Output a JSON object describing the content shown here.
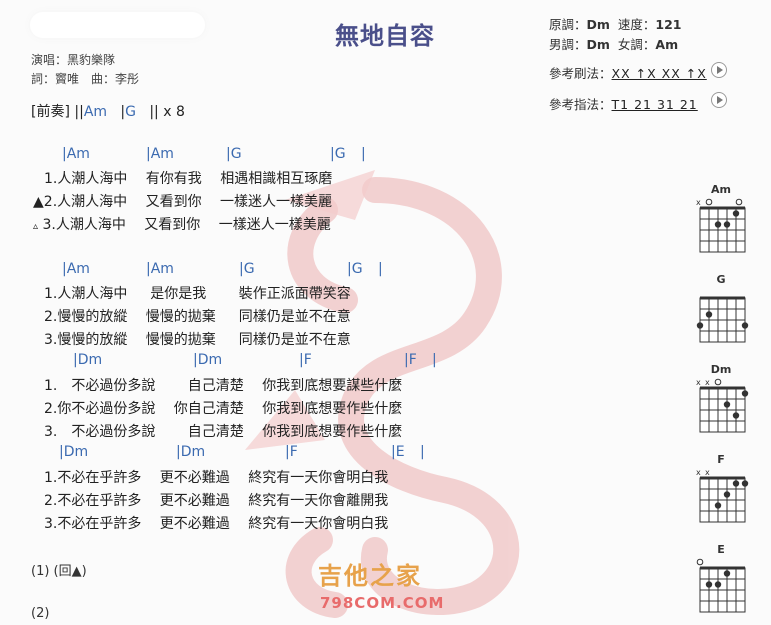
{
  "title": "無地自容",
  "meta": {
    "singer": "演唱：黑豹樂隊",
    "writers": "詞：竇唯　曲：李彤"
  },
  "keys": {
    "original_label": "原調：",
    "original_value": "Dm",
    "tempo_label": "速度：",
    "tempo_value": "121",
    "male_label": "男調：",
    "male_value": "Dm",
    "female_label": "女調：",
    "female_value": "Am"
  },
  "reference": {
    "strum_label": "參考刷法：",
    "strum_value": "XX ↑X XX ↑X",
    "pick_label": "參考指法：",
    "pick_value": "T1 21 31 21"
  },
  "intro": {
    "label": "[前奏]",
    "open": "||",
    "c1": "Am",
    "sep": "|",
    "c2": "G",
    "close": "|| x 8"
  },
  "sections": [
    {
      "chords": [
        "|Am",
        "|Am",
        "|G",
        "|G",
        "|"
      ],
      "lines": [
        {
          "mark": "",
          "num": "1.",
          "text": "人潮人海中　 有你有我 　相遇相識相互琢磨"
        },
        {
          "mark": "▲",
          "num": "2.",
          "text": "人潮人海中　 又看到你 　一樣迷人一樣美麗"
        },
        {
          "mark": "▵",
          "num": "3.",
          "text": "人潮人海中　 又看到你 　一樣迷人一樣美麗"
        }
      ]
    },
    {
      "chords": [
        "|Am",
        "|Am",
        "|G",
        "|G",
        "|"
      ],
      "lines": [
        {
          "mark": "",
          "num": "1.",
          "text": "人潮人海中 　 是你是我 　　裝作正派面帶笑容"
        },
        {
          "mark": "",
          "num": "2.",
          "text": "慢慢的放縱 　慢慢的拋棄 　 同樣仍是並不在意"
        },
        {
          "mark": "",
          "num": "3.",
          "text": "慢慢的放縱 　慢慢的拋棄 　 同樣仍是並不在意"
        }
      ]
    },
    {
      "chords": [
        "|Dm",
        "|Dm",
        "|F",
        "|F",
        "|"
      ],
      "lines": [
        {
          "mark": "",
          "num": "1.",
          "text": "　不必過份多說 　　自己清楚　 你我到底想要謀些什麼"
        },
        {
          "mark": "",
          "num": "2.",
          "text": "你不必過份多說 　你自己清楚　 你我到底想要作些什麼"
        },
        {
          "mark": "",
          "num": "3.",
          "text": "　不必過份多說 　　自己清楚　 你我到底想要作些什麼"
        }
      ]
    },
    {
      "chords": [
        "|Dm",
        "|Dm",
        "|F",
        "|E",
        "|"
      ],
      "lines": [
        {
          "mark": "",
          "num": "1.",
          "text": "不必在乎許多　 更不必難過　 終究有一天你會明白我"
        },
        {
          "mark": "",
          "num": "2.",
          "text": "不必在乎許多　 更不必難過　 終究有一天你會離開我"
        },
        {
          "mark": "",
          "num": "3.",
          "text": "不必在乎許多　 更不必難過　 終究有一天你會明白我"
        }
      ]
    }
  ],
  "footer": {
    "line1": "(1)  (回▲)",
    "line2": "(2)"
  },
  "chord_diagrams": [
    {
      "name": "Am",
      "marks": "xo   o"
    },
    {
      "name": "G",
      "marks": ""
    },
    {
      "name": "Dm",
      "marks": "xxo"
    },
    {
      "name": "F",
      "marks": "xx"
    },
    {
      "name": "E",
      "marks": "o"
    }
  ],
  "brand": {
    "cn": "吉他之家",
    "en": "798COM.COM"
  },
  "colors": {
    "title": "#4a4f8a",
    "chord": "#3b6ab0",
    "watermark": "#e8a0a0",
    "brand_cn": "#e7a24b",
    "brand_en": "#e86b6b"
  }
}
